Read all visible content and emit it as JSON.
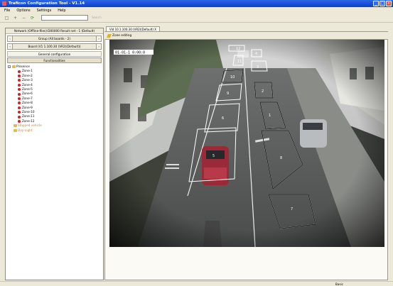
{
  "window": {
    "title": "Traficon Configuration Tool - V1.14"
  },
  "menu": [
    "File",
    "Options",
    "Settings",
    "Help"
  ],
  "toolbar": {
    "go_label": "Search"
  },
  "left": {
    "network_header": "Network (Offline-files):D00000 Result net - 1 (Default)",
    "group_label": "Group (All boards - 2)",
    "board_label": "Board (V1 1.100.30 (VR2)(Default))",
    "general_config": "General configuration",
    "functionalities": "Functionalities",
    "tree": {
      "presence": "Presence",
      "zones": [
        "Zone-1",
        "Zone-2",
        "Zone-3",
        "Zone-4",
        "Zone-5",
        "Zone-6",
        "Zone-7",
        "Zone-8",
        "Zone-9",
        "Zone-10",
        "Zone-11",
        "Zone-12"
      ],
      "stopped": "Stopped vehicle",
      "day_night": "Day-night"
    }
  },
  "tab": {
    "label": "Vid 10.1.100.30 (VR2)(Default) X"
  },
  "subbar": {
    "label": "Zone editing"
  },
  "video": {
    "overlay_text": "01-01-1 0:00:0",
    "zone_numbers": [
      "12",
      "11",
      "10",
      "9",
      "6",
      "5",
      "4",
      "3",
      "2",
      "1",
      "8",
      "7"
    ]
  },
  "status": {
    "text": "Basic"
  }
}
